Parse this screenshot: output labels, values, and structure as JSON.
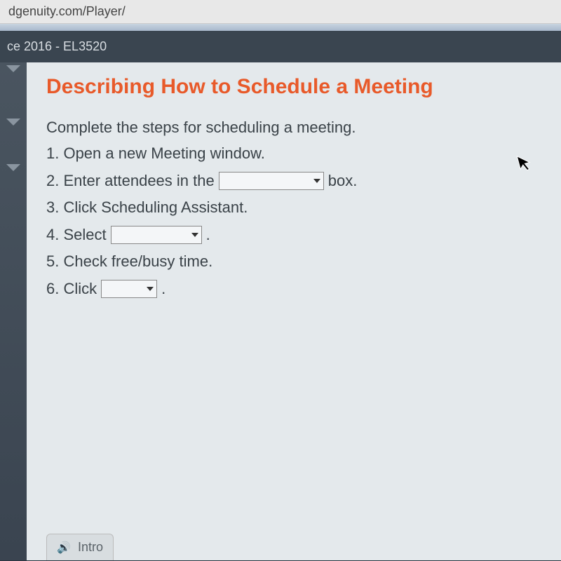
{
  "browser": {
    "url_fragment": "dgenuity.com/Player/"
  },
  "nav": {
    "course_label": "ce 2016 - EL3520"
  },
  "lesson": {
    "title": "Describing How to Schedule a Meeting",
    "instruction": "Complete the steps for scheduling a meeting.",
    "step1": "1. Open a new Meeting window.",
    "step2_pre": "2. Enter attendees in the",
    "step2_post": "box.",
    "step3": "3. Click Scheduling Assistant.",
    "step4_pre": "4. Select",
    "step4_post": ".",
    "step5": "5. Check free/busy time.",
    "step6_pre": "6. Click",
    "step6_post": "."
  },
  "footer": {
    "intro_label": "Intro"
  }
}
